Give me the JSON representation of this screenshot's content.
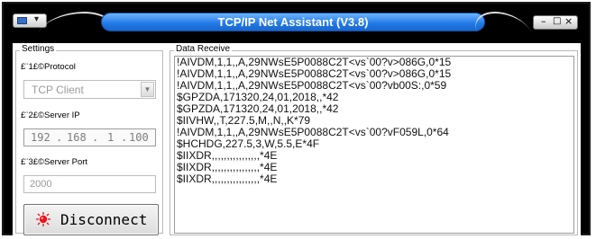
{
  "window": {
    "title": "TCP/IP Net Assistant (V3.8)",
    "controls": {
      "minimize": "–",
      "maximize": "□",
      "close": "×"
    }
  },
  "settings": {
    "legend": "Settings",
    "protocol_label": "£¨1£©Protocol",
    "protocol_value": "TCP Client",
    "server_ip_label": "£¨2£©Server IP",
    "server_ip": [
      "192",
      "168",
      "1",
      "100"
    ],
    "server_port_label": "£¨3£©Server Port",
    "server_port": "2000",
    "disconnect_label": "Disconnect",
    "led_color": "#e8141c"
  },
  "data_receive": {
    "legend": "Data Receive",
    "lines": [
      "!AIVDM,1,1,,A,29NWsE5P0088C2T<vs`00?v>086G,0*15",
      "!AIVDM,1,1,,A,29NWsE5P0088C2T<vs`00?v>086G,0*15",
      "!AIVDM,1,1,,A,29NWsE5P0088C2T<vs`00?vb00S:,0*59",
      "$GPZDA,171320,24,01,2018,,*42",
      "$GPZDA,171320,24,01,2018,,*42",
      "$IIVHW,,T,227.5,M,,N,,K*79",
      "!AIVDM,1,1,,A,29NWsE5P0088C2T<vs`00?vF059L,0*64",
      "$HCHDG,227.5,3,W,5.5,E*4F",
      "$IIXDR,,,,,,,,,,,,,,,,*4E",
      "$IIXDR,,,,,,,,,,,,,,,,*4E",
      "$IIXDR,,,,,,,,,,,,,,,,*4E"
    ]
  },
  "colors": {
    "title_bar": "#1f78e6",
    "frame": "#000000"
  }
}
